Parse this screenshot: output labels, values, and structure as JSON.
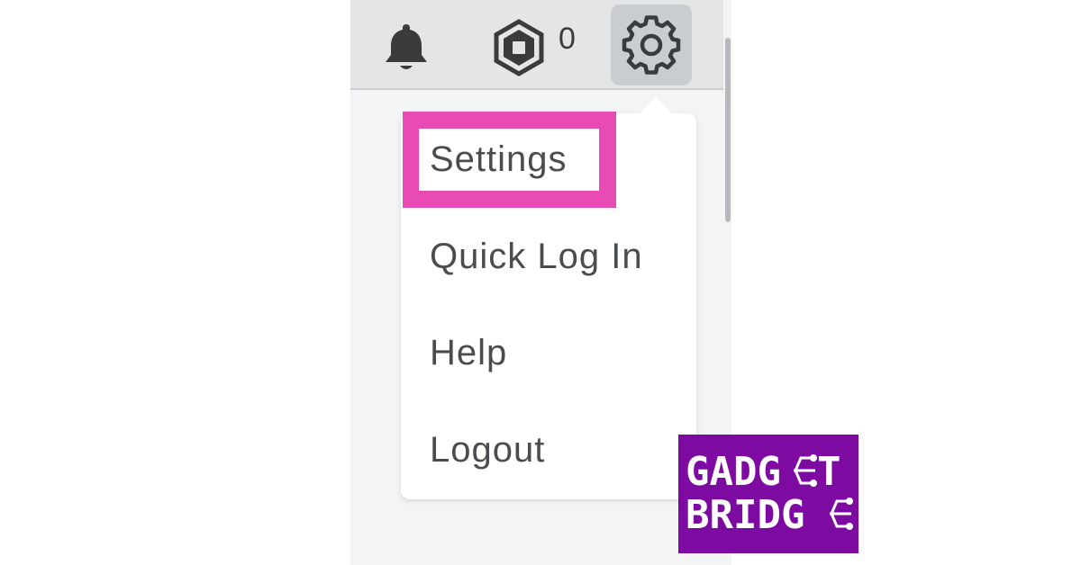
{
  "header": {
    "robux_count": "0",
    "icons": {
      "notifications": "bell-icon",
      "currency": "robux-icon",
      "settings": "gear-icon"
    }
  },
  "settings_menu": {
    "items": [
      {
        "label": "Settings",
        "highlighted": true
      },
      {
        "label": "Quick Log In"
      },
      {
        "label": "Help"
      },
      {
        "label": "Logout"
      }
    ],
    "highlight_color": "#e84bb3"
  },
  "watermark": {
    "line1": "GADGET",
    "line2": "BRIDGE",
    "background_color": "#7d0ba1"
  }
}
